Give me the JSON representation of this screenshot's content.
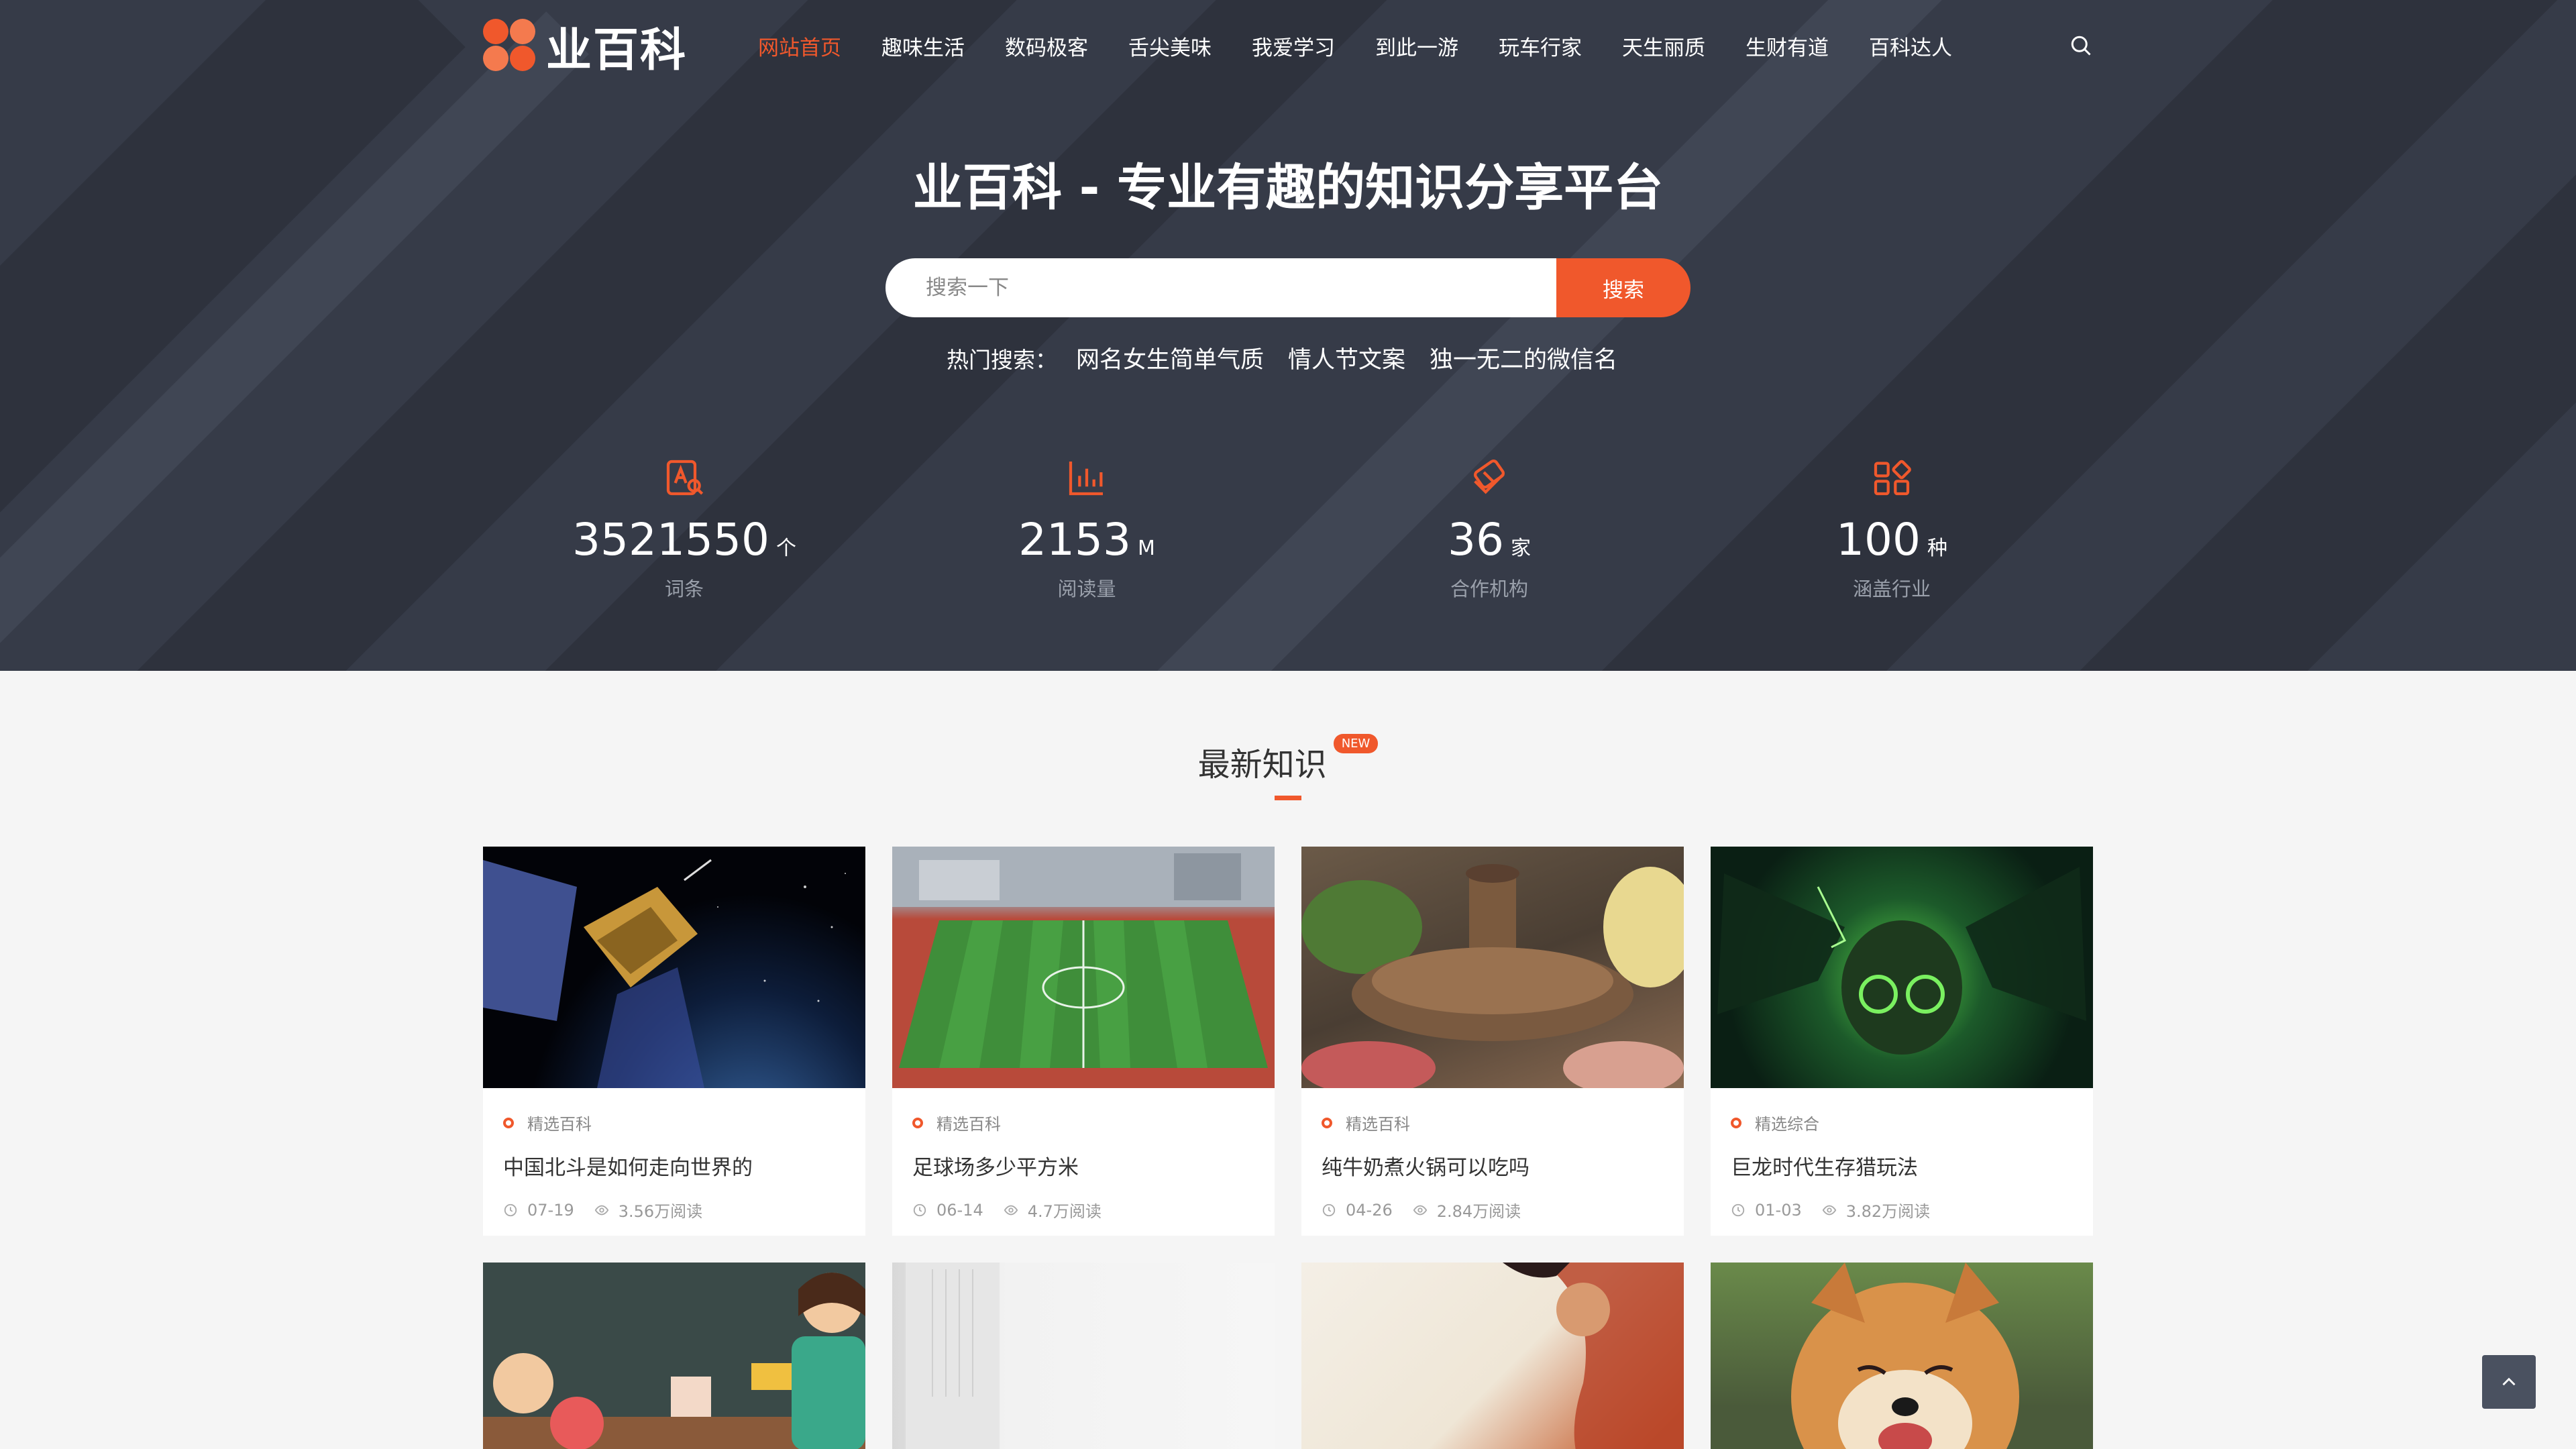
{
  "brand": {
    "name": "业百科"
  },
  "nav": {
    "items": [
      "网站首页",
      "趣味生活",
      "数码极客",
      "舌尖美味",
      "我爱学习",
      "到此一游",
      "玩车行家",
      "天生丽质",
      "生财有道",
      "百科达人"
    ]
  },
  "hero": {
    "title": "业百科 - 专业有趣的知识分享平台",
    "search_placeholder": "搜索一下",
    "search_button": "搜索",
    "hot_label": "热门搜索：",
    "hot_links": [
      "网名女生简单气质",
      "情人节文案",
      "独一无二的微信名"
    ]
  },
  "stats": [
    {
      "value": "3521550",
      "unit": "个",
      "caption": "词条",
      "icon": "book-search-icon"
    },
    {
      "value": "2153",
      "unit": "M",
      "caption": "阅读量",
      "icon": "bar-chart-icon"
    },
    {
      "value": "36",
      "unit": "家",
      "caption": "合作机构",
      "icon": "handshake-icon"
    },
    {
      "value": "100",
      "unit": "种",
      "caption": "涵盖行业",
      "icon": "apps-grid-icon"
    }
  ],
  "latest": {
    "title": "最新知识",
    "badge": "NEW",
    "cards": [
      {
        "category": "精选百科",
        "title": "中国北斗是如何走向世界的",
        "date": "07-19",
        "reads": "3.56万阅读"
      },
      {
        "category": "精选百科",
        "title": "足球场多少平方米",
        "date": "06-14",
        "reads": "4.7万阅读"
      },
      {
        "category": "精选百科",
        "title": "纯牛奶煮火锅可以吃吗",
        "date": "04-26",
        "reads": "2.84万阅读"
      },
      {
        "category": "精选综合",
        "title": "巨龙时代生存猎玩法",
        "date": "01-03",
        "reads": "3.82万阅读"
      }
    ]
  },
  "colors": {
    "accent": "#f0582c",
    "hero_bg": "#363b48"
  }
}
